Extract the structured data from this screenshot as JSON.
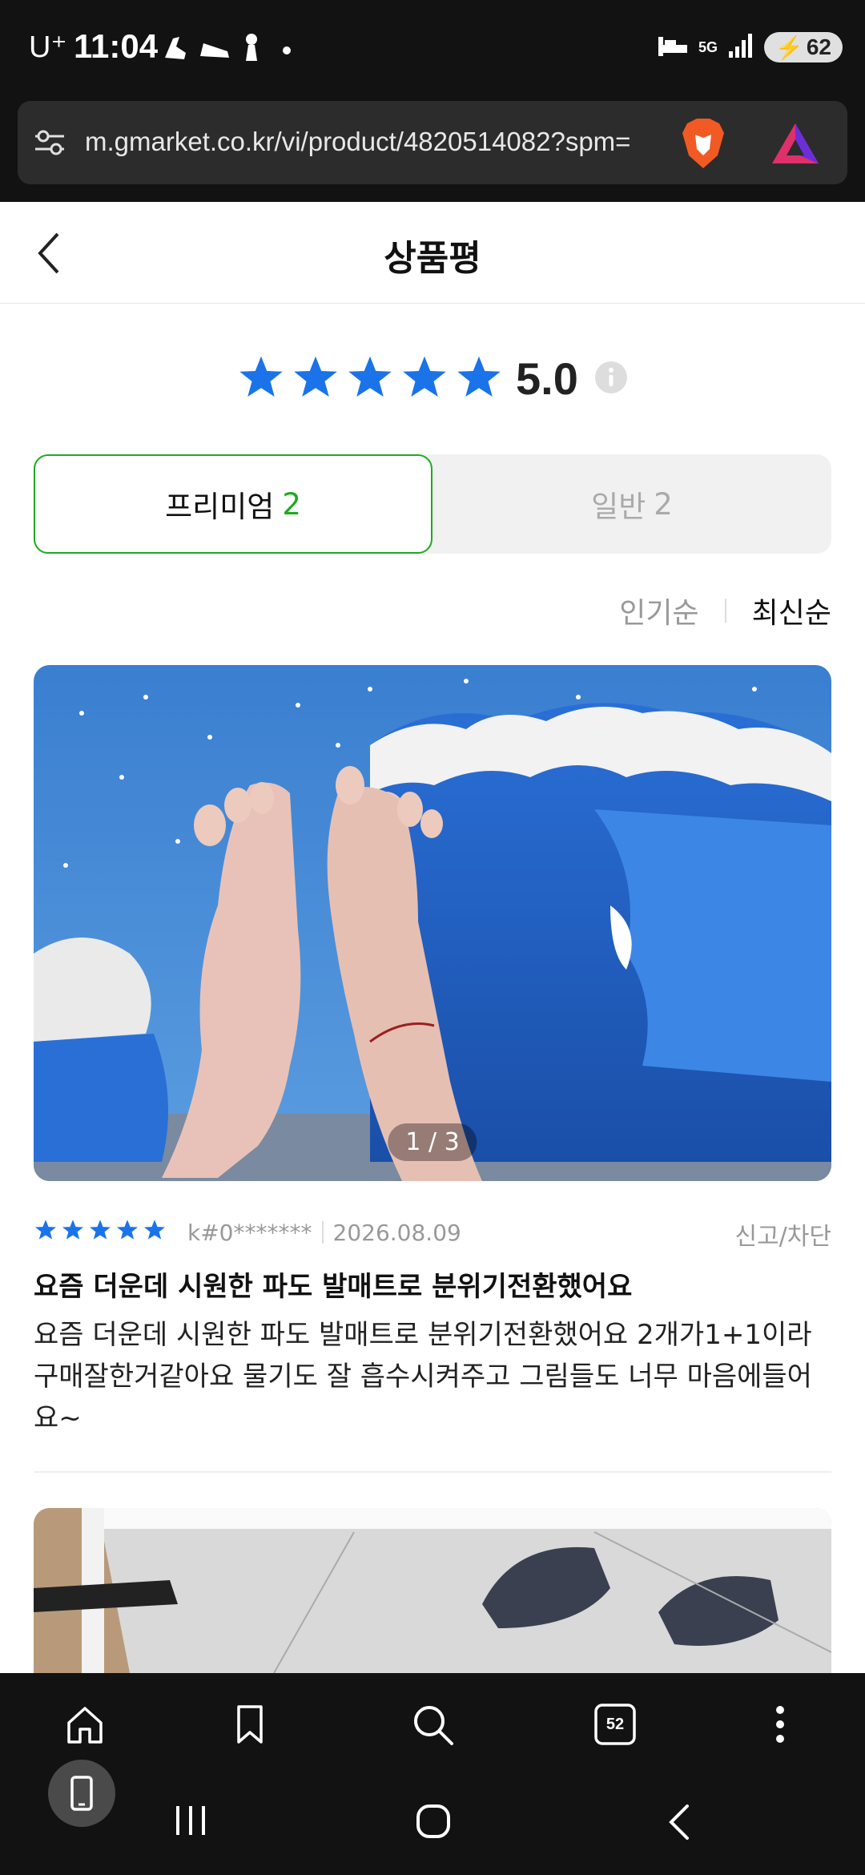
{
  "status_bar": {
    "carrier": "U⁺",
    "time": "11:04",
    "network": "5G",
    "battery": "62"
  },
  "browser": {
    "url": "m.gmarket.co.kr/vi/product/4820514082?spm="
  },
  "header": {
    "title": "상품평"
  },
  "rating": {
    "score": "5.0",
    "stars": 5
  },
  "tabs": {
    "premium_label": "프리미엄",
    "premium_count": "2",
    "general_label": "일반",
    "general_count": "2"
  },
  "sort": {
    "popular": "인기순",
    "latest": "최신순"
  },
  "review": {
    "photo_counter": "1 / 3",
    "stars": 5,
    "user": "k#0*******",
    "date": "2026.08.09",
    "report": "신고/차단",
    "title": "요즘 더운데 시원한 파도 발매트로 분위기전환했어요",
    "body": "요즘 더운데 시원한 파도 발매트로 분위기전환했어요 2개가1+1이라 구매잘한거같아요 물기도 잘 흡수시켜주고 그림들도 너무 마음에들어요~"
  },
  "bottom_nav": {
    "tab_count": "52",
    "icons": [
      "home-icon",
      "bookmark-icon",
      "search-icon",
      "tabs-icon",
      "more-icon"
    ]
  },
  "colors": {
    "star": "#1a73e8",
    "accent_green": "#1fa91f"
  }
}
